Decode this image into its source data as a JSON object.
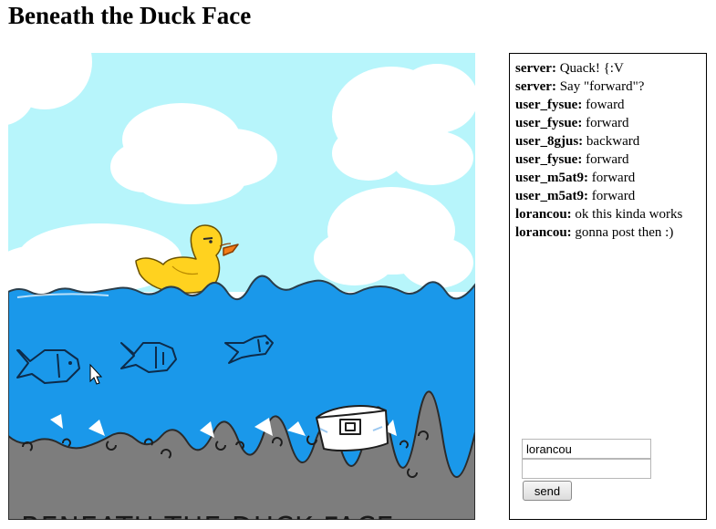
{
  "page": {
    "title": "Beneath the Duck Face"
  },
  "game": {
    "caption": "BENEATH THE DUCK FACE",
    "colors": {
      "sky": "#b7f5fb",
      "water": "#1a98ea",
      "ground": "#7d7d7d",
      "duck": "#ffd21f",
      "beak": "#f47c19",
      "cloud": "#ffffff"
    },
    "elements": [
      "cloud",
      "duck",
      "fish",
      "treasure-chest",
      "rocks",
      "mouse-cursor"
    ]
  },
  "chat": {
    "messages": [
      {
        "user": "server:",
        "text": " Quack! {:V"
      },
      {
        "user": "server:",
        "text": " Say \"forward\"?"
      },
      {
        "user": "user_fysue:",
        "text": " foward"
      },
      {
        "user": "user_fysue:",
        "text": " forward"
      },
      {
        "user": "user_8gjus:",
        "text": " backward"
      },
      {
        "user": "user_fysue:",
        "text": " forward"
      },
      {
        "user": "user_m5at9:",
        "text": " forward"
      },
      {
        "user": "user_m5at9:",
        "text": " forward"
      },
      {
        "user": "lorancou:",
        "text": " ok this kinda works"
      },
      {
        "user": "lorancou:",
        "text": " gonna post then :)"
      }
    ],
    "name_value": "lorancou",
    "message_value": "",
    "send_label": "send"
  }
}
